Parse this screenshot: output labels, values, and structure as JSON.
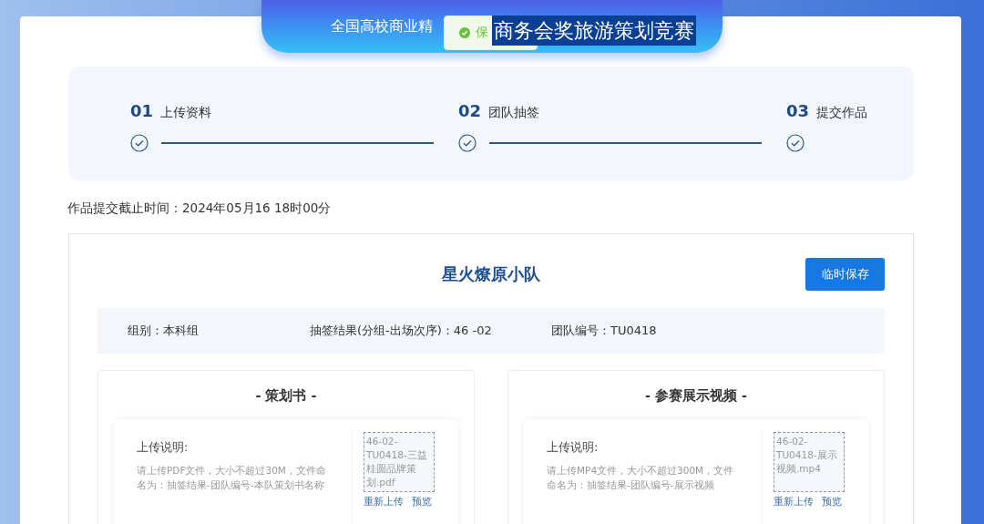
{
  "header": {
    "title": "全国高校商业精"
  },
  "toast": {
    "text": "保",
    "kind": "success"
  },
  "overlay_caption": "商务会奖旅游策划竞赛",
  "steps": [
    {
      "number": "01",
      "label": "上传资料",
      "done": true
    },
    {
      "number": "02",
      "label": "团队抽签",
      "done": true
    },
    {
      "number": "03",
      "label": "提交作品",
      "done": true
    }
  ],
  "deadline": "作品提交截止时间：2024年05月16 18时00分",
  "team": {
    "name": "星火燎原小队",
    "save_button": "临时保存",
    "info": [
      "组别：本科组",
      "抽签结果(分组-出场次序)：46 -02",
      "团队编号：TU0418"
    ]
  },
  "uploads": [
    {
      "title": "- 策划书 -",
      "instructions_label": "上传说明:",
      "instructions": "请上传PDF文件，大小不超过30M，文件命名为：抽签结果-团队编号-本队策划书名称",
      "file": "46-02-TU0418-三益桂圆品牌策划.pdf",
      "actions": [
        "重新上传",
        "预览"
      ]
    },
    {
      "title": "- 参赛展示视频 -",
      "instructions_label": "上传说明:",
      "instructions": "请上传MP4文件，大小不超过300M，文件命名为：抽签结果-团队编号-展示视频",
      "file": "46-02-TU0418-展示视频.mp4",
      "actions": [
        "重新上传",
        "预览"
      ]
    }
  ]
}
